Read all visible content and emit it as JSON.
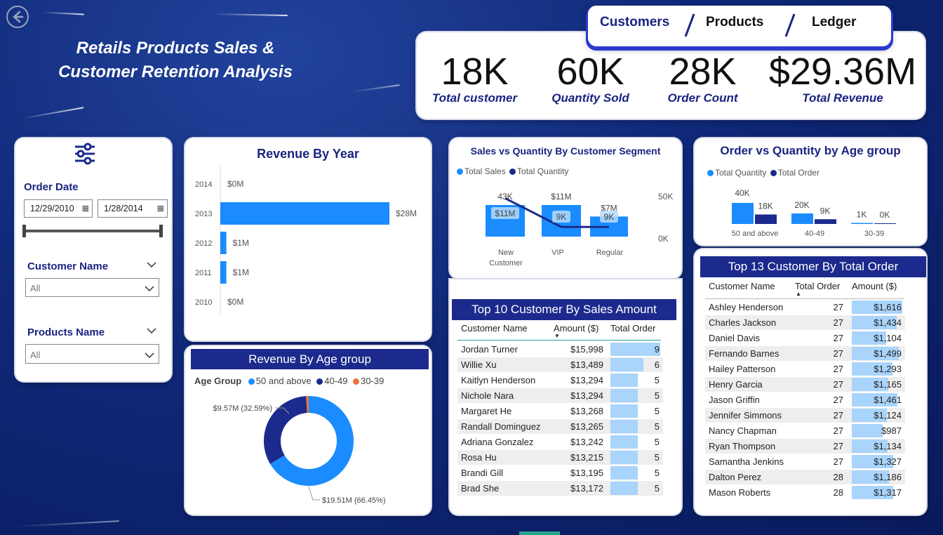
{
  "title_line1": "Retails Products Sales &",
  "title_line2": "Customer Retention Analysis",
  "nav_tabs": [
    "Customers",
    "Products",
    "Ledger"
  ],
  "kpis": [
    {
      "value": "18K",
      "label": "Total customer"
    },
    {
      "value": "60K",
      "label": "Quantity Sold"
    },
    {
      "value": "28K",
      "label": "Order Count"
    },
    {
      "value": "$29.36M",
      "label": "Total Revenue"
    }
  ],
  "filters": {
    "order_date_label": "Order Date",
    "start_date": "12/29/2010",
    "end_date": "1/28/2014",
    "customer_label": "Customer Name",
    "customer_value": "All",
    "products_label": "Products Name",
    "products_value": "All"
  },
  "colors": {
    "accent": "#1a8cff",
    "navy": "#1b2a8c",
    "orange": "#e8743b",
    "bar_light": "#a9d4fb"
  },
  "revenue_by_year": {
    "title": "Revenue By Year",
    "chart_data": {
      "type": "bar",
      "orientation": "horizontal",
      "categories": [
        "2014",
        "2013",
        "2012",
        "2011",
        "2010"
      ],
      "values": [
        0,
        28,
        1,
        1,
        0
      ],
      "labels": [
        "$0M",
        "$28M",
        "$1M",
        "$1M",
        "$0M"
      ],
      "unit": "$M"
    }
  },
  "revenue_by_age": {
    "title": "Revenue By Age group",
    "legend_title": "Age Group",
    "chart_data": {
      "type": "pie",
      "donut": true,
      "categories": [
        "50 and above",
        "40-49",
        "30-39"
      ],
      "values": [
        19.51,
        9.57,
        0.28
      ],
      "labels": [
        "$19.51M (66.45%)",
        "$9.57M (32.59%)",
        ""
      ],
      "colors": [
        "#1a8cff",
        "#1b2a8c",
        "#e8743b"
      ]
    }
  },
  "sales_vs_qty": {
    "title": "Sales vs Quantity By Customer Segment",
    "legend": [
      "Total Sales",
      "Total Quantity"
    ],
    "chart_data": {
      "type": "bar",
      "categories": [
        "New Customer",
        "VIP",
        "Regular"
      ],
      "series": [
        {
          "name": "Total Sales",
          "values": [
            11,
            11,
            7
          ],
          "top_labels": [
            "43K",
            "$11M",
            "$7M"
          ],
          "inner_labels": [
            "$11M",
            "9K",
            "9K"
          ]
        },
        {
          "name": "Total Quantity",
          "values": [
            43,
            9,
            9
          ]
        }
      ],
      "secondary_ticks": [
        "50K",
        "0K"
      ]
    }
  },
  "order_vs_qty": {
    "title": "Order vs Quantity by Age group",
    "legend": [
      "Total Quantity",
      "Total Order"
    ],
    "chart_data": {
      "type": "bar",
      "categories": [
        "50 and above",
        "40-49",
        "30-39"
      ],
      "series": [
        {
          "name": "Total Quantity",
          "values": [
            40,
            20,
            1
          ],
          "labels": [
            "40K",
            "20K",
            "1K"
          ]
        },
        {
          "name": "Total Order",
          "values": [
            18,
            9,
            0
          ],
          "labels": [
            "18K",
            "9K",
            "0K"
          ]
        }
      ]
    }
  },
  "top10": {
    "title": "Top 10 Customer By Sales Amount",
    "headers": [
      "Customer Name",
      "Amount ($)",
      "Total Order"
    ],
    "rows": [
      {
        "name": "Jordan Turner",
        "amount": "$15,998",
        "orders": "9",
        "v": 9
      },
      {
        "name": "Willie Xu",
        "amount": "$13,489",
        "orders": "6",
        "v": 6
      },
      {
        "name": "Kaitlyn Henderson",
        "amount": "$13,294",
        "orders": "5",
        "v": 5
      },
      {
        "name": "Nichole Nara",
        "amount": "$13,294",
        "orders": "5",
        "v": 5
      },
      {
        "name": "Margaret He",
        "amount": "$13,268",
        "orders": "5",
        "v": 5
      },
      {
        "name": "Randall Dominguez",
        "amount": "$13,265",
        "orders": "5",
        "v": 5
      },
      {
        "name": "Adriana Gonzalez",
        "amount": "$13,242",
        "orders": "5",
        "v": 5
      },
      {
        "name": "Rosa Hu",
        "amount": "$13,215",
        "orders": "5",
        "v": 5
      },
      {
        "name": "Brandi Gill",
        "amount": "$13,195",
        "orders": "5",
        "v": 5
      },
      {
        "name": "Brad She",
        "amount": "$13,172",
        "orders": "5",
        "v": 5
      }
    ]
  },
  "top13": {
    "title": "Top 13 Customer By Total Order",
    "headers": [
      "Customer Name",
      "Total Order",
      "Amount ($)"
    ],
    "rows": [
      {
        "name": "Ashley Henderson",
        "orders": "27",
        "amount": "$1,616",
        "v": 1616
      },
      {
        "name": "Charles Jackson",
        "orders": "27",
        "amount": "$1,434",
        "v": 1434
      },
      {
        "name": "Daniel Davis",
        "orders": "27",
        "amount": "$1,104",
        "v": 1104
      },
      {
        "name": "Fernando Barnes",
        "orders": "27",
        "amount": "$1,499",
        "v": 1499
      },
      {
        "name": "Hailey Patterson",
        "orders": "27",
        "amount": "$1,293",
        "v": 1293
      },
      {
        "name": "Henry Garcia",
        "orders": "27",
        "amount": "$1,165",
        "v": 1165
      },
      {
        "name": "Jason Griffin",
        "orders": "27",
        "amount": "$1,461",
        "v": 1461
      },
      {
        "name": "Jennifer Simmons",
        "orders": "27",
        "amount": "$1,124",
        "v": 1124
      },
      {
        "name": "Nancy Chapman",
        "orders": "27",
        "amount": "$987",
        "v": 987
      },
      {
        "name": "Ryan Thompson",
        "orders": "27",
        "amount": "$1,134",
        "v": 1134
      },
      {
        "name": "Samantha Jenkins",
        "orders": "27",
        "amount": "$1,327",
        "v": 1327
      },
      {
        "name": "Dalton Perez",
        "orders": "28",
        "amount": "$1,186",
        "v": 1186
      },
      {
        "name": "Mason Roberts",
        "orders": "28",
        "amount": "$1,317",
        "v": 1317
      }
    ]
  }
}
